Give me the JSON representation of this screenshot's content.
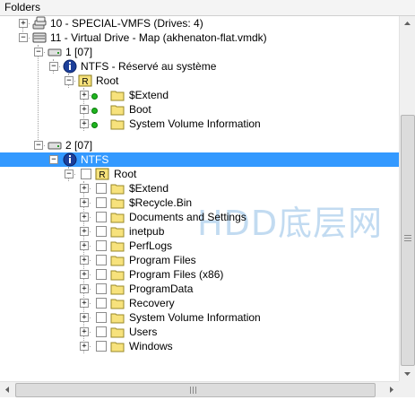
{
  "header": {
    "title": "Folders"
  },
  "tree": [
    {
      "label": "10 - SPECIAL-VMFS (Drives: 4)",
      "icon": "disk-multi-icon",
      "expander": "+",
      "checkbox": false
    },
    {
      "label": "11 - Virtual Drive - Map (akhenaton-flat.vmdk)",
      "icon": "virtual-drive-icon",
      "expander": "-",
      "checkbox": false
    },
    {
      "label": "1 [07]",
      "icon": "partition-icon",
      "expander": "-",
      "checkbox": false
    },
    {
      "label": "NTFS - Réservé au système",
      "icon": "ntfs-volume-icon",
      "expander": "-",
      "checkbox": false,
      "green": true
    },
    {
      "label": "Root",
      "icon": "root-folder-icon",
      "expander": "-",
      "checkbox": false,
      "green": true
    },
    {
      "label": "$Extend",
      "icon": "folder-icon",
      "expander": "+",
      "checkbox": false,
      "green": true
    },
    {
      "label": "Boot",
      "icon": "folder-icon",
      "expander": "+",
      "checkbox": false,
      "green": true
    },
    {
      "label": "System Volume Information",
      "icon": "folder-icon",
      "expander": "+",
      "checkbox": false,
      "green": true
    },
    {
      "label": "2 [07]",
      "icon": "partition-icon",
      "expander": "-",
      "checkbox": false
    },
    {
      "label": "NTFS",
      "icon": "ntfs-volume-icon",
      "expander": "-",
      "checkbox": false,
      "selected": true
    },
    {
      "label": "Root",
      "icon": "root-folder-icon",
      "expander": "-",
      "checkbox": true
    },
    {
      "label": "$Extend",
      "icon": "folder-icon",
      "expander": "+",
      "checkbox": true
    },
    {
      "label": "$Recycle.Bin",
      "icon": "folder-icon",
      "expander": "+",
      "checkbox": true
    },
    {
      "label": "Documents and Settings",
      "icon": "folder-icon",
      "expander": "+",
      "checkbox": true
    },
    {
      "label": "inetpub",
      "icon": "folder-icon",
      "expander": "+",
      "checkbox": true
    },
    {
      "label": "PerfLogs",
      "icon": "folder-icon",
      "expander": "+",
      "checkbox": true
    },
    {
      "label": "Program Files",
      "icon": "folder-icon",
      "expander": "+",
      "checkbox": true
    },
    {
      "label": "Program Files (x86)",
      "icon": "folder-icon",
      "expander": "+",
      "checkbox": true
    },
    {
      "label": "ProgramData",
      "icon": "folder-icon",
      "expander": "+",
      "checkbox": true
    },
    {
      "label": "Recovery",
      "icon": "folder-icon",
      "expander": "+",
      "checkbox": true
    },
    {
      "label": "System Volume Information",
      "icon": "folder-icon",
      "expander": "+",
      "checkbox": true
    },
    {
      "label": "Users",
      "icon": "folder-icon",
      "expander": "+",
      "checkbox": true
    },
    {
      "label": "Windows",
      "icon": "folder-icon",
      "expander": "+",
      "checkbox": true
    }
  ],
  "watermark": "HDD底层网",
  "colors": {
    "selection": "#3399ff",
    "folder": "#f7e27c",
    "green": "#1fb51f"
  }
}
